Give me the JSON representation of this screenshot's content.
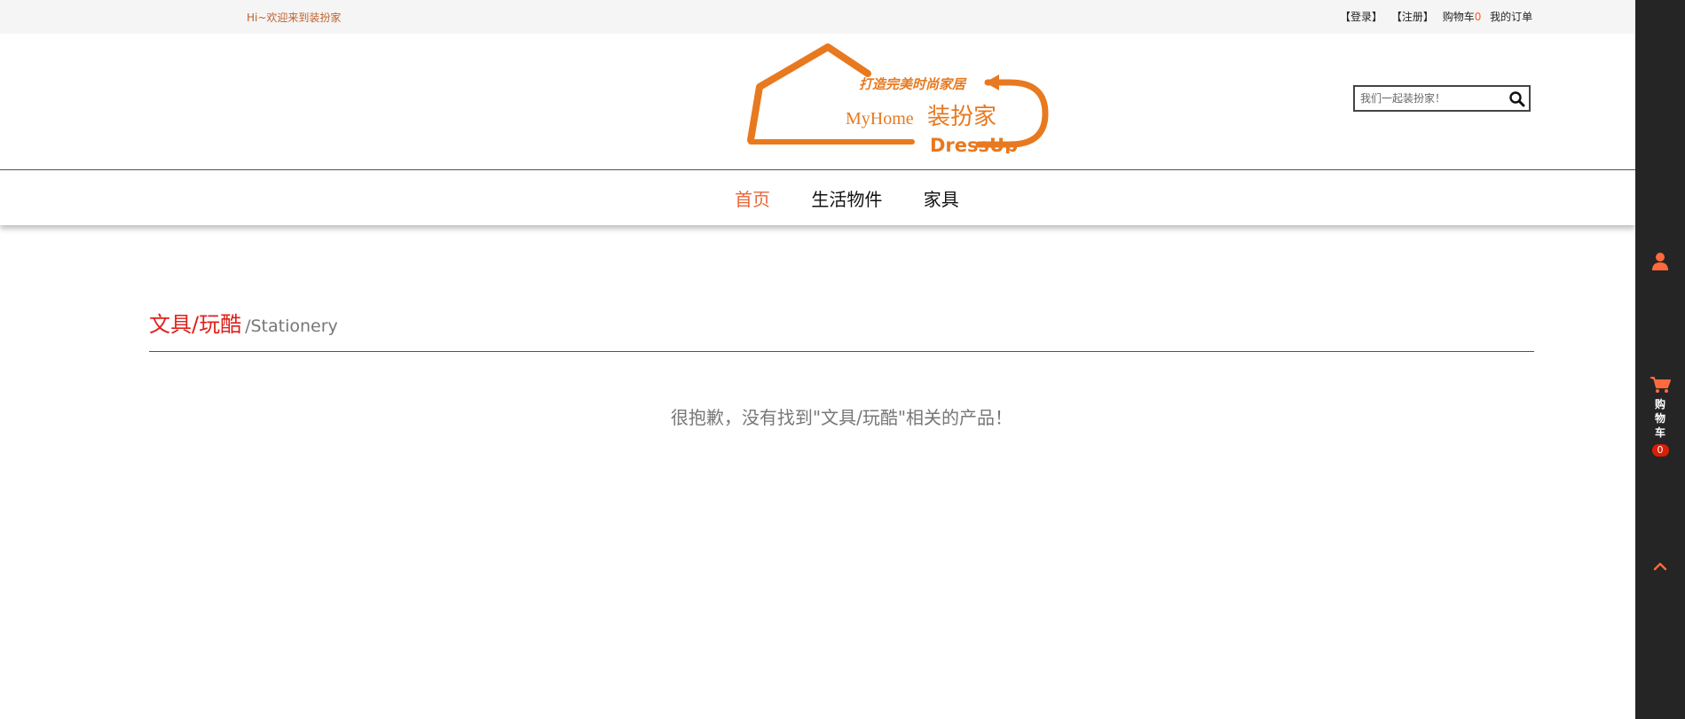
{
  "topbar": {
    "welcome": "Hi~欢迎来到装扮家",
    "login": "【登录】",
    "register": "【注册】",
    "cart_label": "购物车",
    "cart_count": "0",
    "orders": "我的订单"
  },
  "logo": {
    "slogan": "打造完美时尚家居",
    "brand_en": "MyHome",
    "brand_cn": "装扮家",
    "brand_sub": "DressUp",
    "color": "#e8791f"
  },
  "search": {
    "placeholder": "我们一起装扮家！",
    "icon": "search-icon"
  },
  "nav": {
    "items": [
      {
        "label": "首页",
        "active": true
      },
      {
        "label": "生活物件",
        "active": false
      },
      {
        "label": "家具",
        "active": false
      }
    ]
  },
  "section": {
    "title_cn": "文具/玩酷",
    "title_en": "/Stationery"
  },
  "empty_message": "很抱歉，没有找到\"文具/玩酷\"相关的产品！",
  "sidebar": {
    "user_icon": "user-icon",
    "cart_icon": "cart-icon",
    "cart_label": "购物车",
    "cart_count": "0",
    "top_icon": "chevron-up-icon",
    "accent": "#ff6a3d"
  }
}
